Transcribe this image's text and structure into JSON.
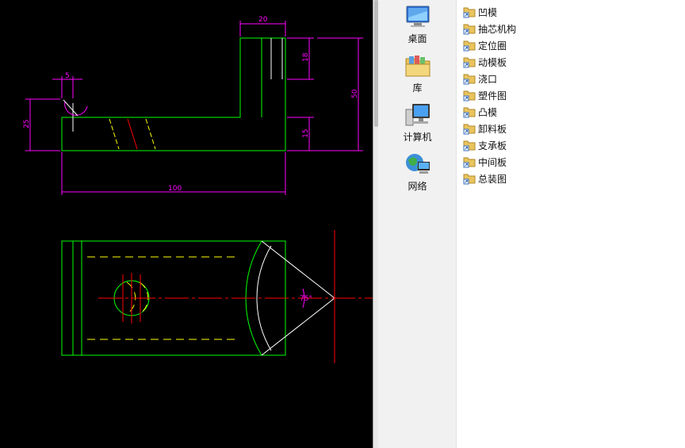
{
  "cad": {
    "dim_width_top": "20",
    "dim_small_top": "5",
    "dim_height_upper": "18",
    "dim_height_total": "50",
    "dim_height_left": "25",
    "dim_height_lower": "15",
    "dim_length_total": "100",
    "dim_angle": "75°",
    "colors": {
      "background": "#000000",
      "outline": "#00ff00",
      "dimension": "#ff00ff",
      "centerline": "#ff0000",
      "hidden": "#ffff00",
      "white": "#ffffff"
    }
  },
  "nav": {
    "items": [
      {
        "label": "桌面",
        "icon": "desktop-icon"
      },
      {
        "label": "库",
        "icon": "library-icon"
      },
      {
        "label": "计算机",
        "icon": "computer-icon"
      },
      {
        "label": "网络",
        "icon": "network-icon"
      }
    ]
  },
  "files": {
    "items": [
      "凹模",
      "抽芯机构",
      "定位圈",
      "动模板",
      "浇口",
      "塑件图",
      "凸模",
      "卸料板",
      "支承板",
      "中间板",
      "总装图"
    ]
  }
}
